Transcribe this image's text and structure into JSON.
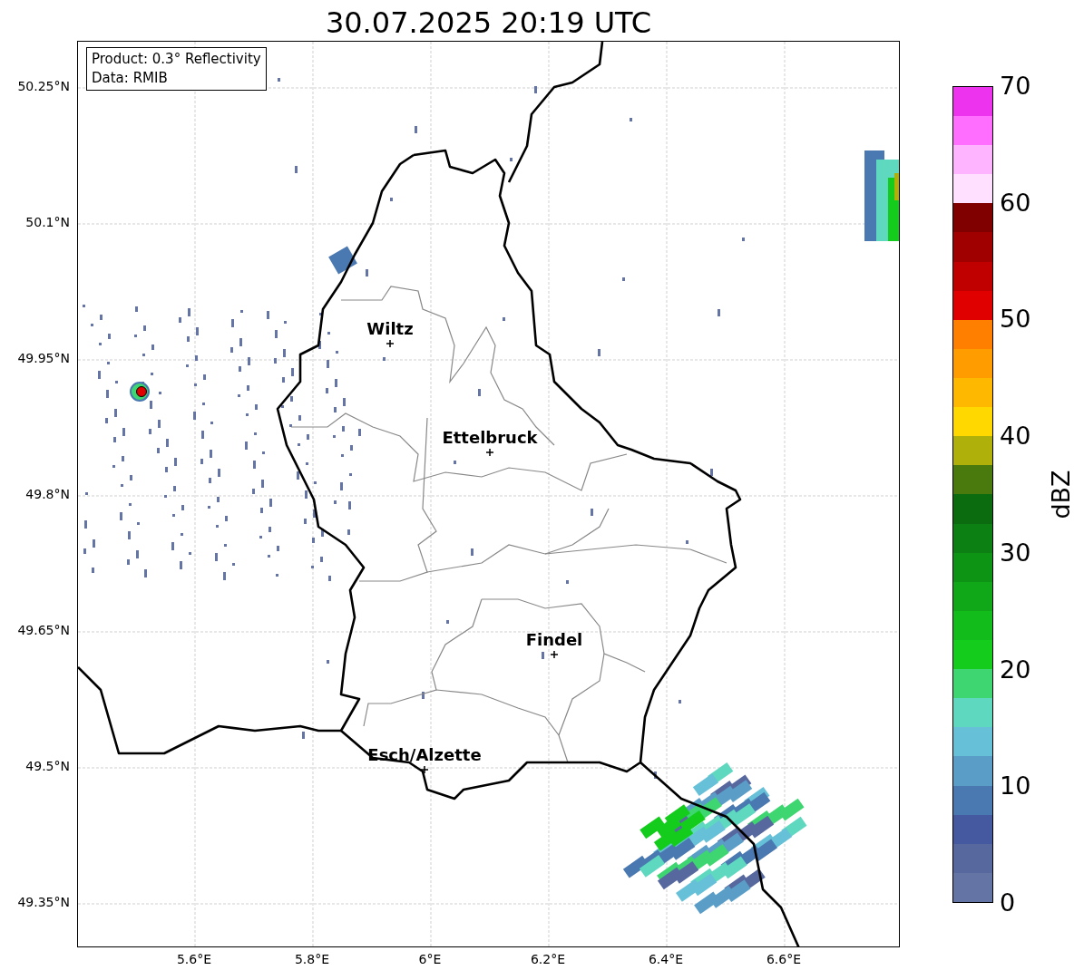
{
  "title": "30.07.2025 20:19 UTC",
  "info_box": [
    "Product: 0.3° Reflectivity",
    "Data: RMIB"
  ],
  "y_ticks": [
    "50.25°N",
    "50.1°N",
    "49.95°N",
    "49.8°N",
    "49.65°N",
    "49.5°N",
    "49.35°N"
  ],
  "x_ticks": [
    "5.6°E",
    "5.8°E",
    "6°E",
    "6.2°E",
    "6.4°E",
    "6.6°E"
  ],
  "cities": [
    {
      "name": "Wiltz"
    },
    {
      "name": "Ettelbruck"
    },
    {
      "name": "Findel"
    },
    {
      "name": "Esch/Alzette"
    }
  ],
  "colorbar": {
    "label": "dBZ",
    "ticks": [
      "70",
      "60",
      "50",
      "40",
      "30",
      "20",
      "10",
      "0"
    ],
    "bins": [
      {
        "color": "#6374a5"
      },
      {
        "color": "#57689f"
      },
      {
        "color": "#4559a0"
      },
      {
        "color": "#4a78b0"
      },
      {
        "color": "#5a9ec8"
      },
      {
        "color": "#66c0d8"
      },
      {
        "color": "#5fd8c0"
      },
      {
        "color": "#3dd670"
      },
      {
        "color": "#14cc1c"
      },
      {
        "color": "#12bc1a"
      },
      {
        "color": "#10a818"
      },
      {
        "color": "#0e9414"
      },
      {
        "color": "#0c8012"
      },
      {
        "color": "#0a6c0e"
      },
      {
        "color": "#4a7a0e"
      },
      {
        "color": "#b0b00a"
      },
      {
        "color": "#ffd800"
      },
      {
        "color": "#ffb800"
      },
      {
        "color": "#ff9c00"
      },
      {
        "color": "#ff8000"
      },
      {
        "color": "#e00000"
      },
      {
        "color": "#c00000"
      },
      {
        "color": "#a00000"
      },
      {
        "color": "#800000"
      },
      {
        "color": "#ffe0ff"
      },
      {
        "color": "#ffb4ff"
      },
      {
        "color": "#ff6eff"
      },
      {
        "color": "#ee33ee"
      }
    ]
  }
}
